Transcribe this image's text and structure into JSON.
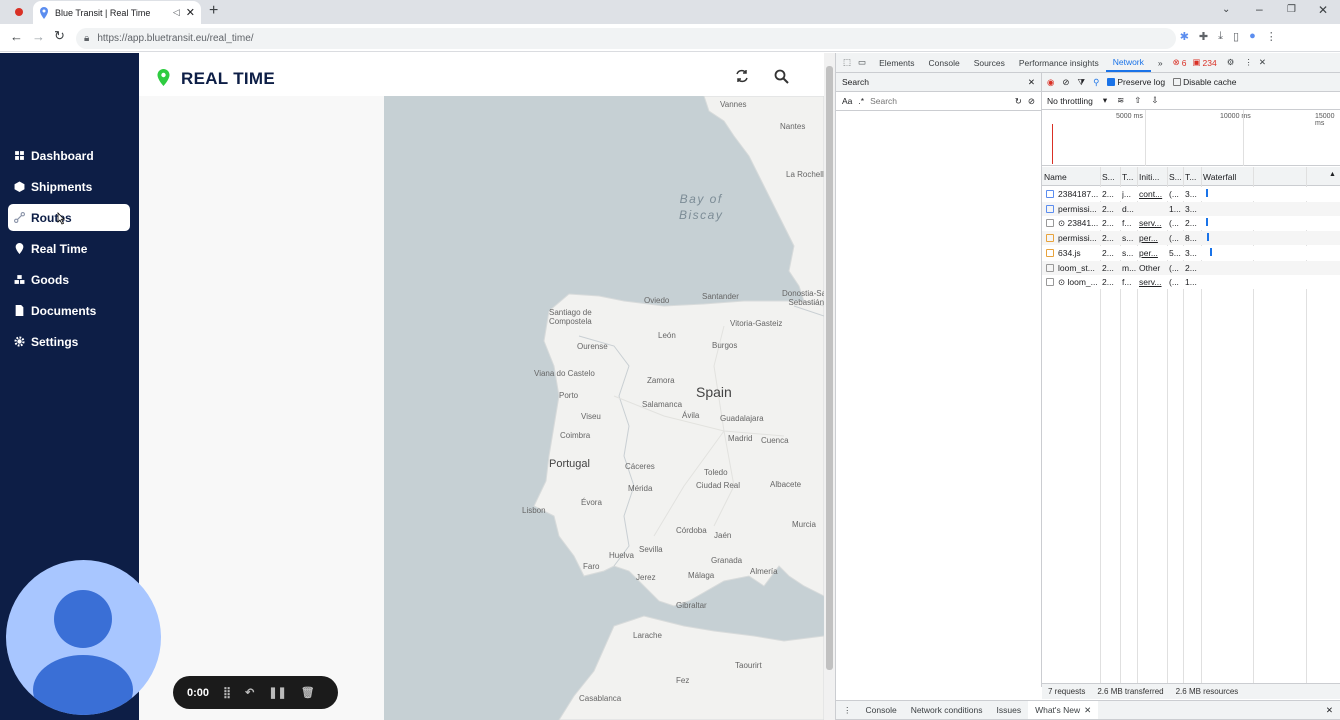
{
  "browser": {
    "tab_title": "Blue Transit | Real Time",
    "url": "https://app.bluetransit.eu/real_time/"
  },
  "sidebar": {
    "items": [
      {
        "label": "Dashboard",
        "icon": "dashboard-icon"
      },
      {
        "label": "Shipments",
        "icon": "box-icon"
      },
      {
        "label": "Routes",
        "icon": "route-icon",
        "active": true
      },
      {
        "label": "Real Time",
        "icon": "location-pin-icon"
      },
      {
        "label": "Goods",
        "icon": "goods-icon"
      },
      {
        "label": "Documents",
        "icon": "document-icon"
      },
      {
        "label": "Settings",
        "icon": "gear-icon"
      }
    ]
  },
  "header": {
    "title": "REAL TIME"
  },
  "map": {
    "labels": {
      "bay": "Bay of\nBiscay",
      "spain": "Spain",
      "portugal": "Portugal",
      "vannes": "Vannes",
      "nantes": "Nantes",
      "la_rochelle": "La Rochelle",
      "santander": "Santander",
      "donostia": "Donostia-San\nSebastián",
      "vitoria": "Vitoria-Gasteiz",
      "oviedo": "Oviedo",
      "santiago": "Santiago de\nCompostela",
      "leon": "León",
      "burgos": "Burgos",
      "ourense": "Ourense",
      "viana": "Viana do Castelo",
      "porto": "Porto",
      "zamora": "Zamora",
      "salamanca": "Salamanca",
      "viseu": "Viseu",
      "avila": "Ávila",
      "guadalajara": "Guadalajara",
      "madrid": "Madrid",
      "cuenca": "Cuenca",
      "coimbra": "Coimbra",
      "caceres": "Cáceres",
      "toledo": "Toledo",
      "merida": "Mérida",
      "ciudad_real": "Ciudad Real",
      "albacete": "Albacete",
      "lisbon": "Lisbon",
      "evora": "Évora",
      "cordoba": "Córdoba",
      "jaen": "Jaén",
      "murcia": "Murcia",
      "huelva": "Huelva",
      "sevilla": "Sevilla",
      "granada": "Granada",
      "faro": "Faro",
      "jerez": "Jerez",
      "malaga": "Málaga",
      "almeria": "Almería",
      "gibraltar": "Gibraltar",
      "larache": "Larache",
      "taourirt": "Taourirt",
      "fez": "Fez",
      "casablanca": "Casablanca"
    }
  },
  "recorder": {
    "time": "0:00"
  },
  "devtools": {
    "tabs": [
      "Elements",
      "Console",
      "Sources",
      "Performance insights",
      "Network"
    ],
    "active_tab": "Network",
    "errors": "6",
    "warnings": "234",
    "search_label": "Search",
    "search_placeholder": "Search",
    "case_label": "Aa",
    "regex_label": ".*",
    "preserve_log": "Preserve log",
    "disable_cache": "Disable cache",
    "throttling": "No throttling",
    "timeline_ticks": [
      "5000 ms",
      "10000 ms",
      "15000 ms"
    ],
    "columns": [
      "Name",
      "S...",
      "T...",
      "Initi...",
      "S...",
      "T...",
      "Waterfall"
    ],
    "rows": [
      [
        "2384187...",
        "2...",
        "j...",
        "cont...",
        "(...",
        "3..."
      ],
      [
        "permissi...",
        "2...",
        "d...",
        "",
        "1...",
        "3..."
      ],
      [
        "⊙ 23841...",
        "2...",
        "f...",
        "serv...",
        "(...",
        "2..."
      ],
      [
        "permissi...",
        "2...",
        "s...",
        "per...",
        "(...",
        "8..."
      ],
      [
        "634.js",
        "2...",
        "s...",
        "per...",
        "5...",
        "3..."
      ],
      [
        "loom_st...",
        "2...",
        "m...",
        "Other",
        "(...",
        "2..."
      ],
      [
        "⊙ loom_...",
        "2...",
        "f...",
        "serv...",
        "(...",
        "1..."
      ]
    ],
    "status": {
      "requests": "7 requests",
      "transferred": "2.6 MB transferred",
      "resources": "2.6 MB resources"
    },
    "drawer_tabs": [
      "Console",
      "Network conditions",
      "Issues",
      "What's New"
    ]
  },
  "colors": {
    "sidebar": "#0d1e46",
    "accent_green": "#2ecc40",
    "devtools_blue": "#1a73e8"
  }
}
